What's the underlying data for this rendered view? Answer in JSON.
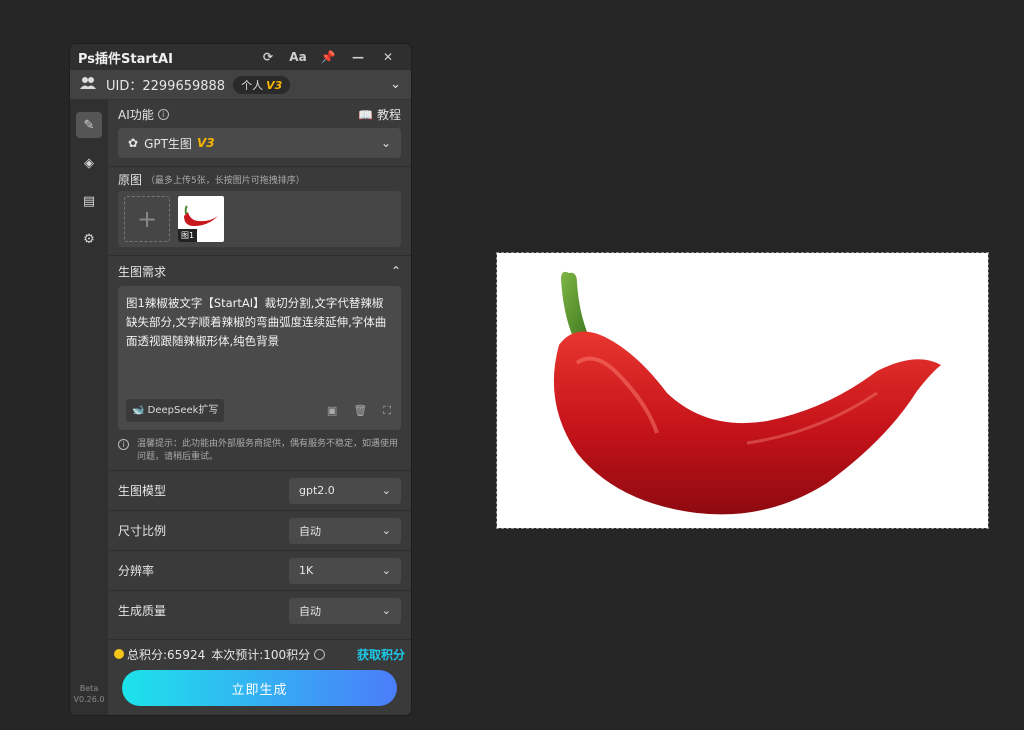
{
  "panel": {
    "title": "Ps插件StartAI",
    "uid": "UID：2299659888",
    "plan": "个人",
    "plan_level": "V3"
  },
  "ai_section": {
    "label": "AI功能",
    "tutorial": "教程",
    "selected_function": "GPT生图",
    "function_level": "V3"
  },
  "original_images": {
    "label": "原图",
    "hint": "（最多上传5张，长按图片可拖拽排序）",
    "images": [
      {
        "tag": "图1"
      }
    ]
  },
  "requirements": {
    "label": "生图需求",
    "text": "图1辣椒被文字【StartAI】裁切分割,文字代替辣椒缺失部分,文字顺着辣椒的弯曲弧度连续延伸,字体曲面透视跟随辣椒形体,纯色背景",
    "deepseek_label": "DeepSeek扩写",
    "warning": "温馨提示：此功能由外部服务商提供，偶有服务不稳定，如遇使用问题，请稍后重试。"
  },
  "options": [
    {
      "label": "生图模型",
      "value": "gpt2.0"
    },
    {
      "label": "尺寸比例",
      "value": "自动"
    },
    {
      "label": "分辨率",
      "value": "1K"
    },
    {
      "label": "生成质量",
      "value": "自动"
    }
  ],
  "footer": {
    "credits": "总积分:65924",
    "estimate": "本次预计:100积分",
    "get_credits": "获取积分",
    "generate": "立即生成"
  },
  "sidebar": {
    "beta": "Beta",
    "version": "V0.26.0"
  },
  "colors": {
    "accent_gold": "#f5b400",
    "link_cyan": "#1ec8e8",
    "gradient_start": "#1de3ea",
    "gradient_end": "#4b7dfa"
  }
}
